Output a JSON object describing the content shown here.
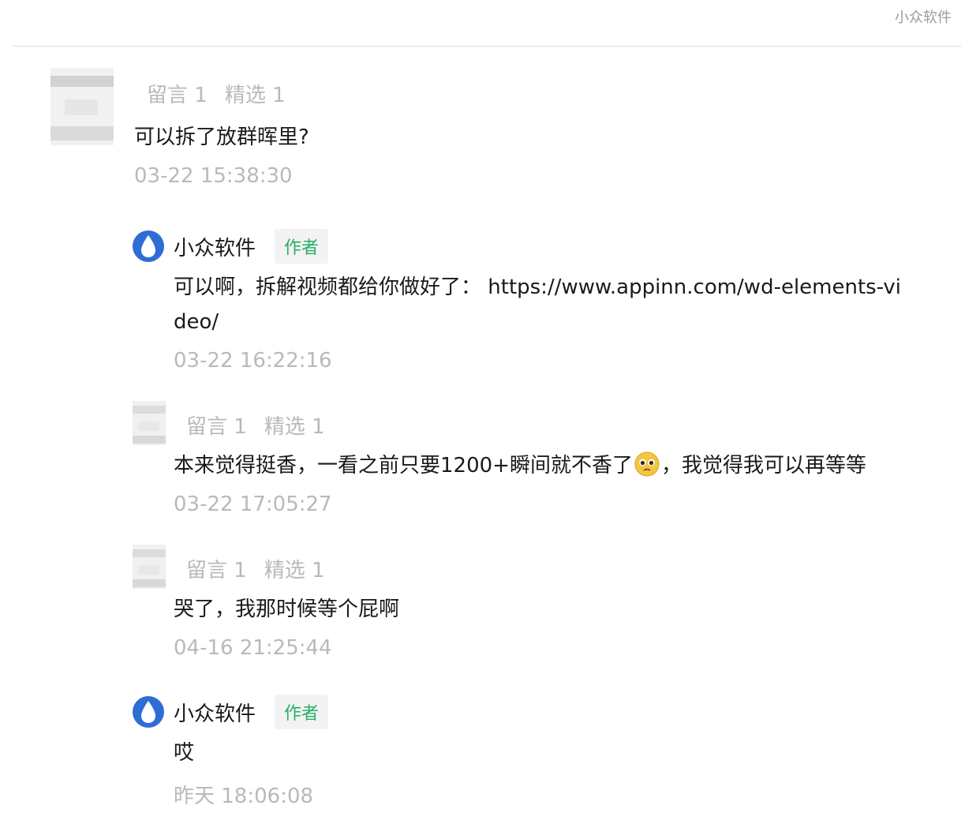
{
  "watermark": "小众软件",
  "comments": [
    {
      "meta": {
        "messages": "留言 1",
        "featured": "精选 1"
      },
      "text": "可以拆了放群晖里?",
      "time": "03-22 15:38:30"
    },
    {
      "author": "小众软件",
      "tag": "作者",
      "text_line1": "可以啊，拆解视频都给你做好了： https://www.appinn.com/wd-elements-vi",
      "text_line2": "deo/",
      "time": "03-22 16:22:16"
    },
    {
      "meta": {
        "messages": "留言 1",
        "featured": "精选 1"
      },
      "text_before": "本来觉得挺香，一看之前只要1200+瞬间就不香了",
      "emoji": "pleading-face-icon",
      "text_after": "，我觉得我可以再等等",
      "time": "03-22 17:05:27"
    },
    {
      "meta": {
        "messages": "留言 1",
        "featured": "精选 1"
      },
      "text": "哭了，我那时候等个屁啊",
      "time": "04-16 21:25:44"
    },
    {
      "author": "小众软件",
      "tag": "作者",
      "text": "哎",
      "time": "昨天 18:06:08"
    }
  ],
  "colors": {
    "author_logo": "#2e6dd6",
    "author_tag_text": "#2aae67",
    "meta_text": "#b9b9b9"
  }
}
